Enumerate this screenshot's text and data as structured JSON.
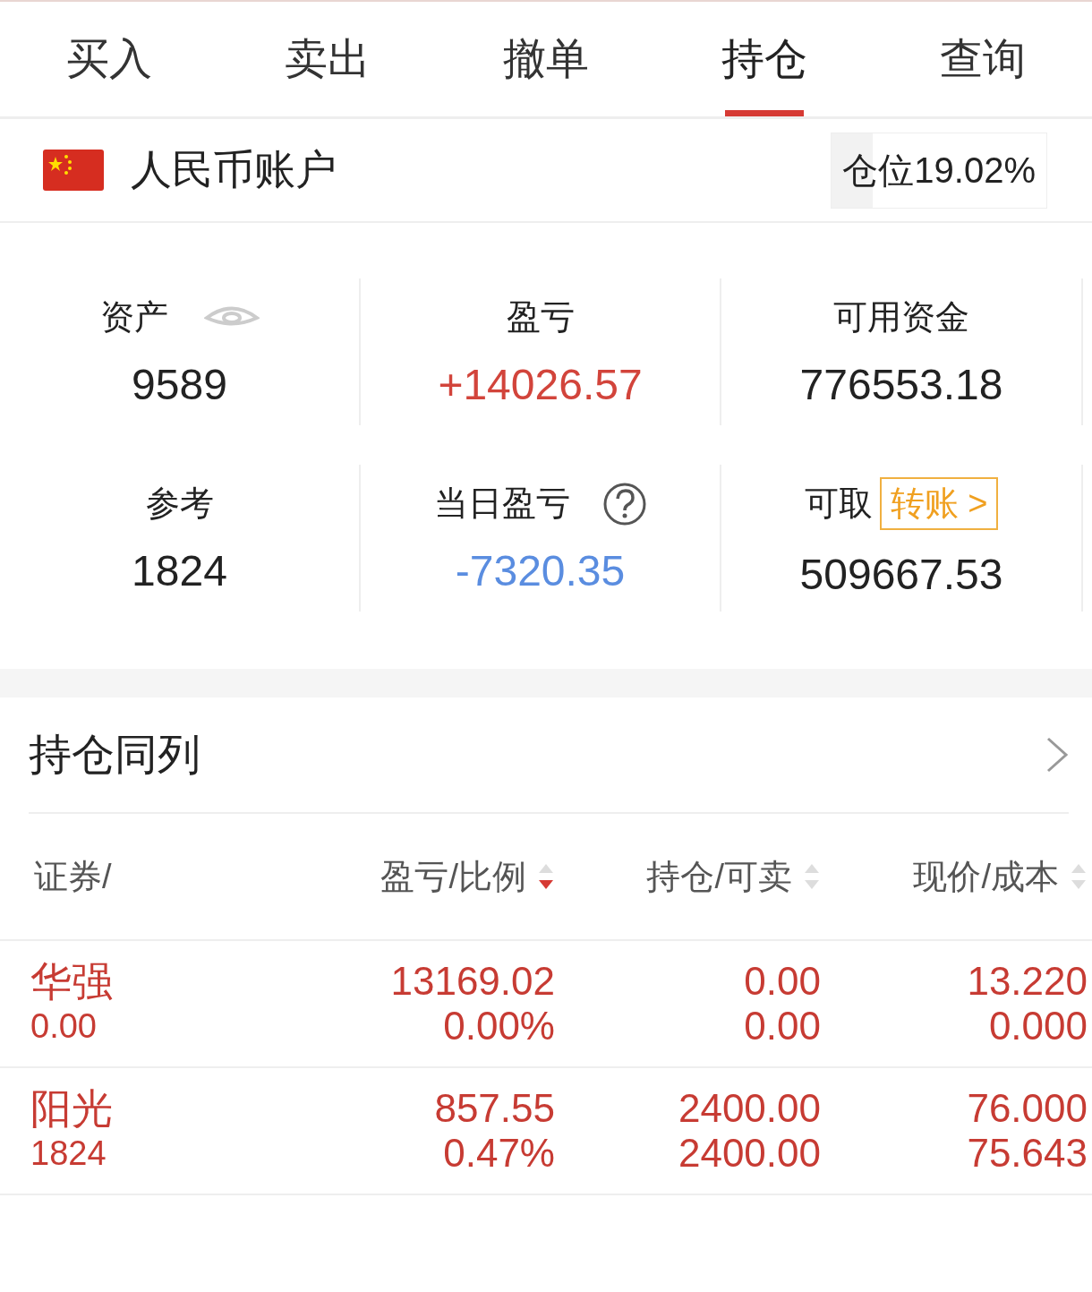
{
  "tabs": [
    {
      "label": "买入",
      "selected": false
    },
    {
      "label": "卖出",
      "selected": false
    },
    {
      "label": "撤单",
      "selected": false
    },
    {
      "label": "持仓",
      "selected": true
    },
    {
      "label": "查询",
      "selected": false
    }
  ],
  "account": {
    "name": "人民币账户",
    "position": "仓位19.02%"
  },
  "stats": [
    {
      "kind": "eye",
      "label": "资产",
      "value": "9589",
      "color": "#222222"
    },
    {
      "kind": "plain",
      "label": "盈亏",
      "value": "+14026.57",
      "color": "#d2443b"
    },
    {
      "kind": "plain",
      "label": "可用资金",
      "value": "776553.18",
      "color": "#222222"
    },
    {
      "kind": "plain",
      "label": "参考",
      "value": "1824",
      "color": "#222222"
    },
    {
      "kind": "help",
      "label": "当日盈亏",
      "value": "-7320.35",
      "color": "#5a8de0"
    },
    {
      "kind": "transfer",
      "label": "可取",
      "button": "转账 >",
      "value": "509667.53",
      "color": "#222222"
    }
  ],
  "holdings": {
    "title": "持仓同列",
    "columns": [
      {
        "label": "证券/"
      },
      {
        "label": "盈亏/比例",
        "sorted": true
      },
      {
        "label": "持仓/可卖",
        "sorted": false
      },
      {
        "label": "现价/成本",
        "sorted": false
      }
    ],
    "rows": [
      {
        "cells": [
          [
            "华强",
            "0.00"
          ],
          [
            "13169.02",
            "0.00%"
          ],
          [
            "0.00",
            "0.00"
          ],
          [
            "13.220",
            "0.000"
          ]
        ]
      },
      {
        "cells": [
          [
            "阳光",
            "1824"
          ],
          [
            "857.55",
            "0.47%"
          ],
          [
            "2400.00",
            "2400.00"
          ],
          [
            "76.000",
            "75.643"
          ]
        ]
      }
    ]
  }
}
